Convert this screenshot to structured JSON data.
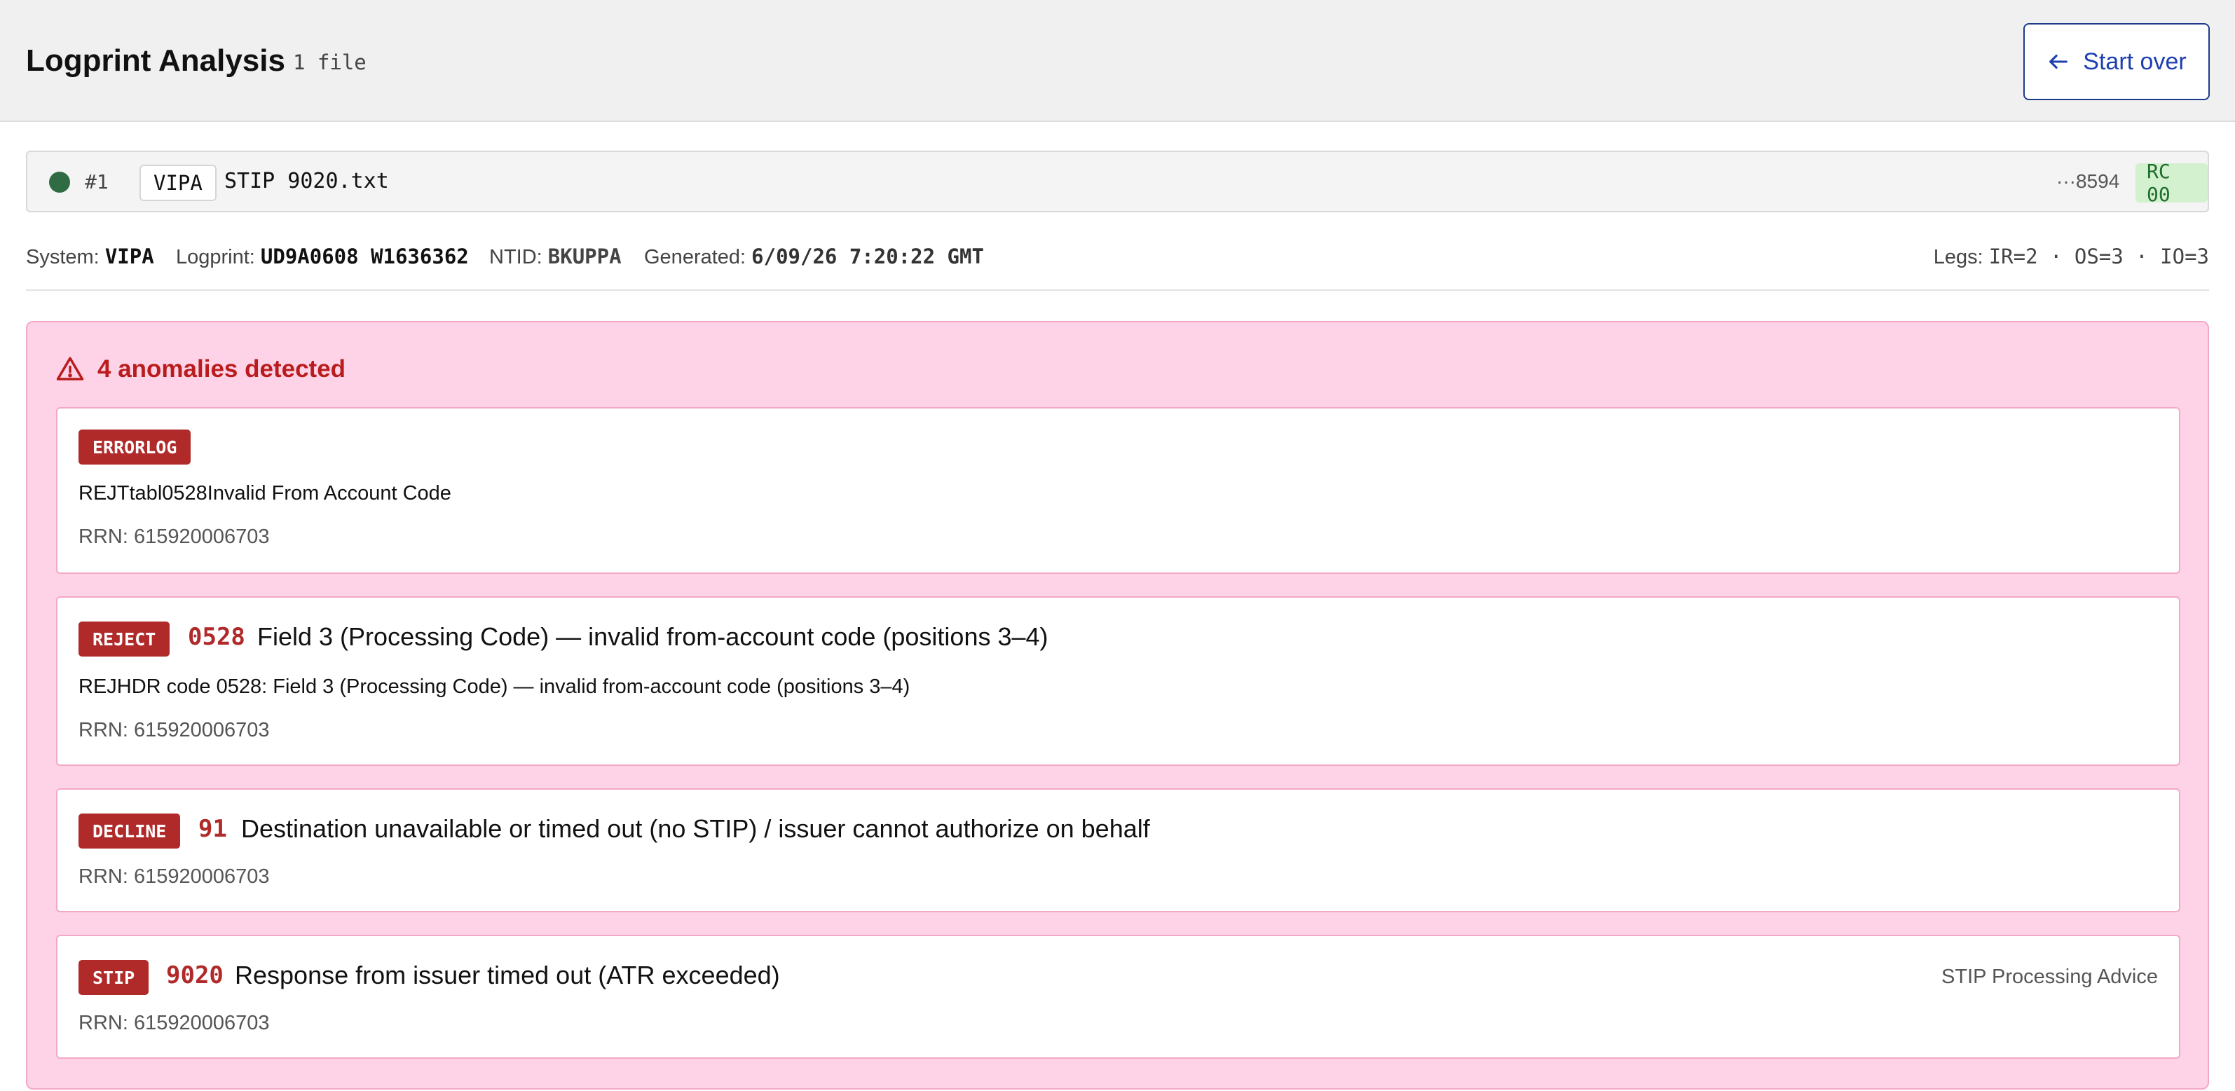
{
  "header": {
    "title": "Logprint Analysis",
    "file_count": "1 file",
    "start_over_label": "Start over"
  },
  "file": {
    "index": "#1",
    "system": "VIPA",
    "name": "STIP 9020.txt",
    "card_suffix": "···8594",
    "rc": "RC 00",
    "status_color": "#2f6b43"
  },
  "meta": {
    "system_label": "System:",
    "system_value": "VIPA",
    "logprint_label": "Logprint:",
    "logprint_value": "UD9A0608 W1636362",
    "ntid_label": "NTID:",
    "ntid_value": "BKUPPA",
    "generated_label": "Generated:",
    "generated_value": "6/09/26 7:20:22 GMT",
    "legs_label": "Legs:",
    "legs_value": "IR=2 · OS=3 · IO=3"
  },
  "anomalies": {
    "heading": "4 anomalies detected",
    "items": [
      {
        "tag": "ERRORLOG",
        "detail": "REJTtabl0528Invalid From Account Code",
        "rrn": "RRN: 615920006703"
      },
      {
        "tag": "REJECT",
        "code": "0528",
        "title": "Field 3 (Processing Code) — invalid from-account code (positions 3–4)",
        "detail": "REJHDR code 0528: Field 3 (Processing Code) — invalid from-account code (positions 3–4)",
        "rrn": "RRN: 615920006703"
      },
      {
        "tag": "DECLINE",
        "code": "91",
        "title": "Destination unavailable or timed out (no STIP) / issuer cannot authorize on behalf",
        "rrn": "RRN: 615920006703"
      },
      {
        "tag": "STIP",
        "code": "9020",
        "title": "Response from issuer timed out (ATR exceeded)",
        "aside": "STIP Processing Advice",
        "rrn": "RRN: 615920006703"
      }
    ]
  },
  "colors": {
    "accent_blue": "#1e40af",
    "danger": "#b02a2a",
    "panel_pink": "#fed3e8",
    "rc_green_bg": "#d3f0cf"
  }
}
